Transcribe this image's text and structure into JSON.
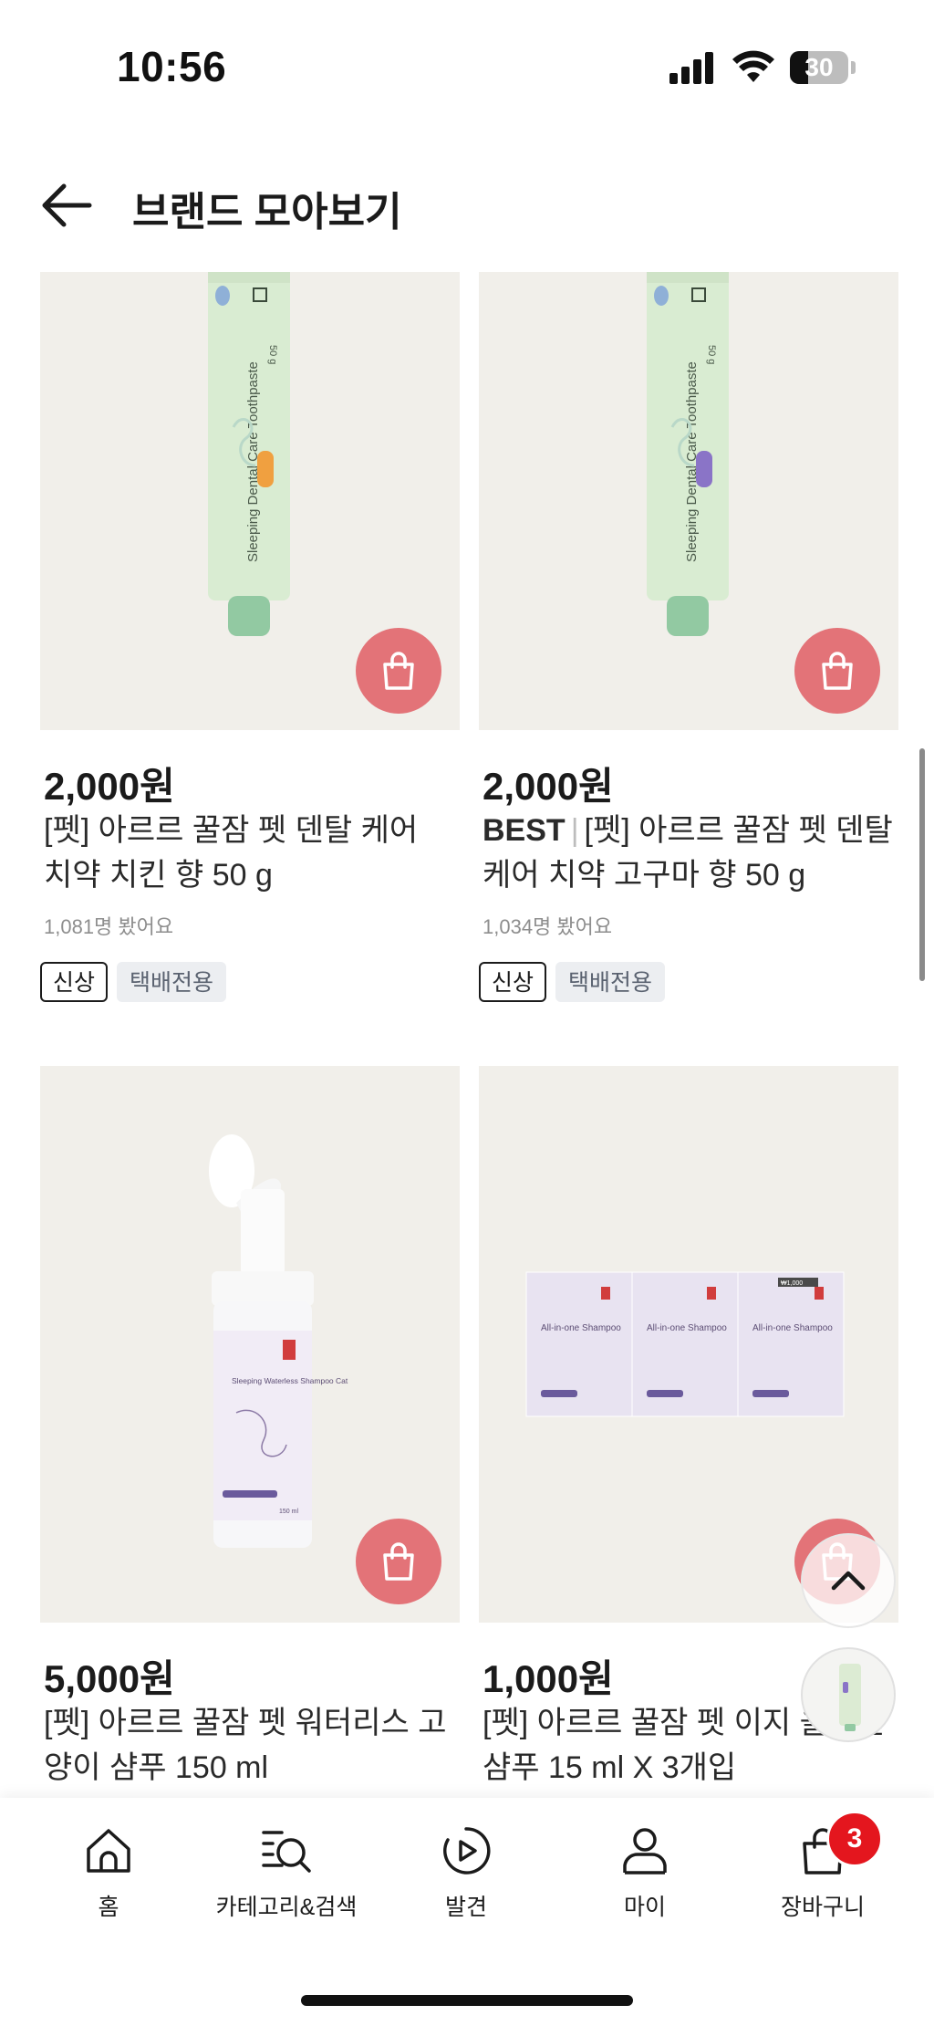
{
  "status_bar": {
    "time": "10:56",
    "battery": "30"
  },
  "header": {
    "title": "브랜드 모아보기"
  },
  "products": [
    {
      "price": "2,000원",
      "best": "",
      "name": "[펫] 아르르 꿀잠 펫 덴탈 케어 치약 치킨 향 50 g",
      "views": "1,081명 봤어요",
      "tags": [
        "신상",
        "택배전용"
      ],
      "package_label": "Sleeping Dental Care Toothpaste",
      "package_weight": "50 g"
    },
    {
      "price": "2,000원",
      "best": "BEST",
      "name": "[펫] 아르르 꿀잠 펫 덴탈 케어 치약 고구마 향 50 g",
      "views": "1,034명 봤어요",
      "tags": [
        "신상",
        "택배전용"
      ],
      "package_label": "Sleeping Dental Care Toothpaste",
      "package_weight": "50 g"
    },
    {
      "price": "5,000원",
      "best": "",
      "name": "[펫] 아르르 꿀잠 펫 워터리스 고양이 샴푸 150 ml",
      "package_label": "Sleeping Waterless Shampoo Cat",
      "package_volume": "150 ml"
    },
    {
      "price": "1,000원",
      "best": "",
      "name": "[펫] 아르르 꿀잠 펫 이지 올인원 샴푸 15 ml X 3개입",
      "package_label": "All-in-one Shampoo",
      "package_price": "₩1,000"
    }
  ],
  "tab_bar": {
    "items": [
      {
        "label": "홈",
        "icon": "home-icon"
      },
      {
        "label": "카테고리&검색",
        "icon": "category-search-icon"
      },
      {
        "label": "발견",
        "icon": "discover-play-icon"
      },
      {
        "label": "마이",
        "icon": "person-icon"
      },
      {
        "label": "장바구니",
        "icon": "shopping-bag-icon"
      }
    ],
    "cart_count": "3"
  },
  "colors": {
    "cart_button": "#e37378",
    "thumb_bg": "#f1efea",
    "badge": "#e4161e",
    "toothpaste_tube": "#d9ecd2"
  }
}
